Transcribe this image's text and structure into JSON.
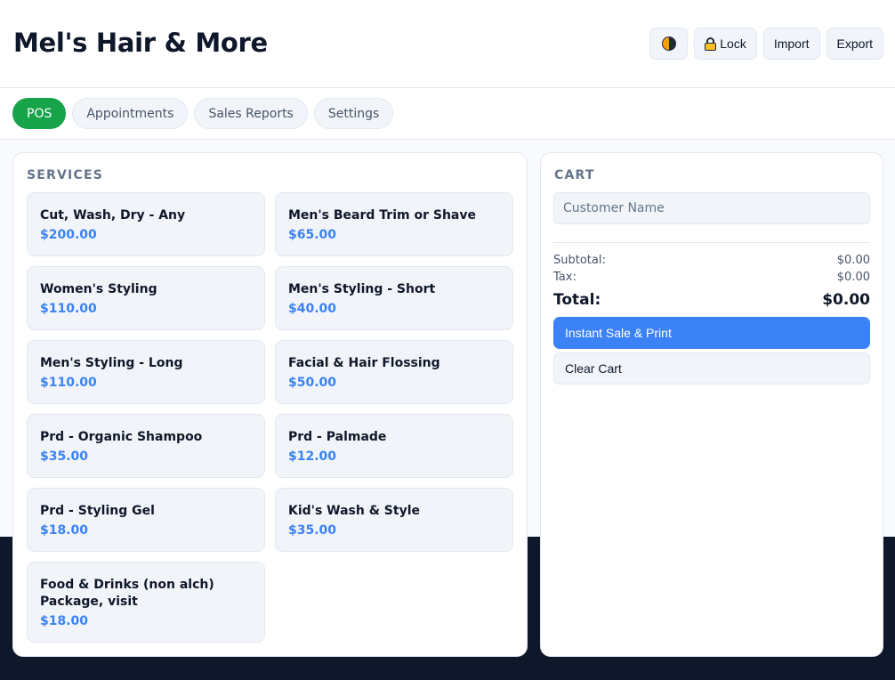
{
  "app": {
    "title": "Mel's Hair & More"
  },
  "header": {
    "theme_icon": "contrast-icon",
    "lock_icon": "lock-icon",
    "lock_label": "Lock",
    "import_label": "Import",
    "export_label": "Export"
  },
  "tabs": [
    {
      "label": "POS",
      "active": true
    },
    {
      "label": "Appointments",
      "active": false
    },
    {
      "label": "Sales Reports",
      "active": false
    },
    {
      "label": "Settings",
      "active": false
    }
  ],
  "services": {
    "heading": "SERVICES",
    "items": [
      {
        "name": "Cut, Wash, Dry - Any",
        "price": "$200.00"
      },
      {
        "name": "Men's Beard Trim or Shave",
        "price": "$65.00"
      },
      {
        "name": "Women's Styling",
        "price": "$110.00"
      },
      {
        "name": "Men's Styling - Short",
        "price": "$40.00"
      },
      {
        "name": "Men's Styling - Long",
        "price": "$110.00"
      },
      {
        "name": "Facial & Hair Flossing",
        "price": "$50.00"
      },
      {
        "name": "Prd - Organic Shampoo",
        "price": "$35.00"
      },
      {
        "name": "Prd - Palmade",
        "price": "$12.00"
      },
      {
        "name": "Prd - Styling Gel",
        "price": "$18.00"
      },
      {
        "name": "Kid's Wash & Style",
        "price": "$35.00"
      },
      {
        "name": "Food & Drinks (non alch) Package, visit",
        "price": "$18.00"
      }
    ]
  },
  "cart": {
    "heading": "CART",
    "customer_placeholder": "Customer Name",
    "customer_value": "",
    "subtotal_label": "Subtotal:",
    "subtotal_value": "$0.00",
    "tax_label": "Tax:",
    "tax_value": "$0.00",
    "total_label": "Total:",
    "total_value": "$0.00",
    "instant_sale_label": "Instant Sale & Print",
    "clear_label": "Clear Cart"
  },
  "colors": {
    "accent_green": "#16a34a",
    "accent_blue": "#3b82f6",
    "footer_dark": "#0f172a"
  }
}
